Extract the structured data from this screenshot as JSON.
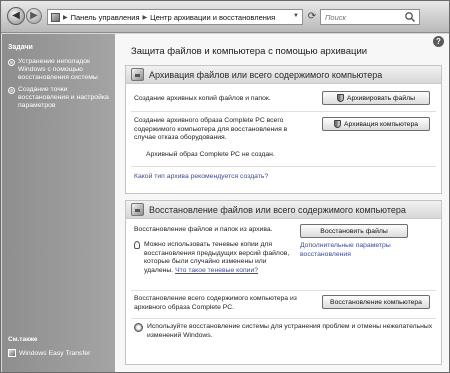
{
  "address_bar": {
    "crumbs": [
      "Панель управления",
      "Центр архивации и восстановления"
    ],
    "search_placeholder": "Поиск"
  },
  "sidebar": {
    "title": "Задачи",
    "tasks": [
      "Устранение неполадок Windows с помощью восстановления системы",
      "Создание точки восстановления и настройка параметров"
    ],
    "see_also_title": "См.также",
    "see_also_items": [
      "Windows Easy Transfer"
    ]
  },
  "main": {
    "title": "Защита файлов и компьютера с помощью архивации",
    "backup_panel": {
      "heading": "Архивация файлов или всего содержимого компьютера",
      "files_text": "Создание архивных копий файлов и папок.",
      "files_button": "Архивировать файлы",
      "complete_text": "Создание архивного образа Complete PC всего содержимого компьютера для восстановления в случае отказа оборудования.",
      "complete_button": "Архивация компьютера",
      "complete_status": "Архивный образ Complete PC не создан.",
      "recommend_link": "Какой тип архива рекомендуется создать?"
    },
    "restore_panel": {
      "heading": "Восстановление файлов или всего содержимого компьютера",
      "files_text": "Восстановление файлов и папок из архива.",
      "files_button": "Восстановить файлы",
      "advanced_link": "Дополнительные параметры восстановления",
      "shadow_text": "Можно использовать теневые копии для восстановления предыдущих версий файлов, которые были случайно изменены или удалены.",
      "shadow_link": "Что такое теневые копии?",
      "complete_text": "Восстановление всего содержимого компьютера из архивного образа Complete PC.",
      "complete_button": "Восстановление компьютера",
      "system_restore_text": "Используйте восстановление системы для устранения проблем и отмены нежелательных изменений Windows."
    }
  }
}
